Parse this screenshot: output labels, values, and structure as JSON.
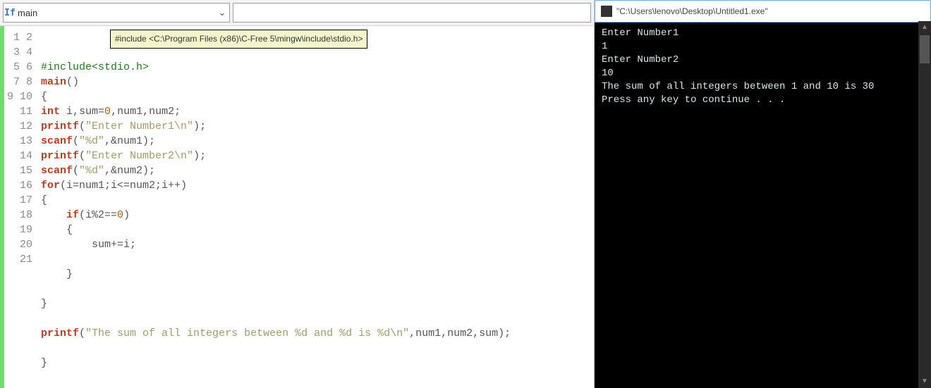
{
  "toolbar": {
    "combo_icon": "If",
    "combo_text": "main"
  },
  "tooltip": "#include <C:\\Program Files (x86)\\C-Free 5\\mingw\\include\\stdio.h>",
  "code": {
    "line_count": 21,
    "lines": {
      "l1": {
        "pp1": "#include<stdio.h>"
      },
      "l2": {
        "kw": "main",
        "rest": "()"
      },
      "l3": {
        "rest": "{"
      },
      "l4": {
        "kw": "int",
        "sp": " ",
        "id1": "i,sum=",
        "n0": "0",
        "id2": ",num1,num2;"
      },
      "l5": {
        "kw": "printf",
        "p": "(",
        "s": "\"Enter Number1\\n\"",
        "e": ");"
      },
      "l6": {
        "kw": "scanf",
        "p": "(",
        "s": "\"%d\"",
        "e": ",&num1);"
      },
      "l7": {
        "kw": "printf",
        "p": "(",
        "s": "\"Enter Number2\\n\"",
        "e": ");"
      },
      "l8": {
        "kw": "scanf",
        "p": "(",
        "s": "\"%d\"",
        "e": ",&num2);"
      },
      "l9": {
        "kw": "for",
        "rest": "(i=num1;i<=num2;i++)"
      },
      "l10": {
        "rest": "{"
      },
      "l11": {
        "kw": "if",
        "rest": "(i%2==",
        "n0": "0",
        "rest2": ")"
      },
      "l12": {
        "rest": "    {"
      },
      "l13": {
        "rest": "        sum+=i;"
      },
      "l14": {
        "rest": ""
      },
      "l15": {
        "rest": "    }"
      },
      "l16": {
        "rest": ""
      },
      "l17": {
        "rest": "}"
      },
      "l18": {
        "rest": ""
      },
      "l19": {
        "kw": "printf",
        "p": "(",
        "s": "\"The sum of all integers between %d and %d is %d\\n\"",
        "e": ",num1,num2,sum);"
      },
      "l20": {
        "rest": ""
      },
      "l21": {
        "rest": "}"
      }
    }
  },
  "console": {
    "title": "\"C:\\Users\\lenovo\\Desktop\\Untitled1.exe\"",
    "lines": {
      "o1": "Enter Number1",
      "o2": "1",
      "o3": "Enter Number2",
      "o4": "10",
      "o5": "The sum of all integers between 1 and 10 is 30",
      "o6": "Press any key to continue . . ."
    }
  }
}
